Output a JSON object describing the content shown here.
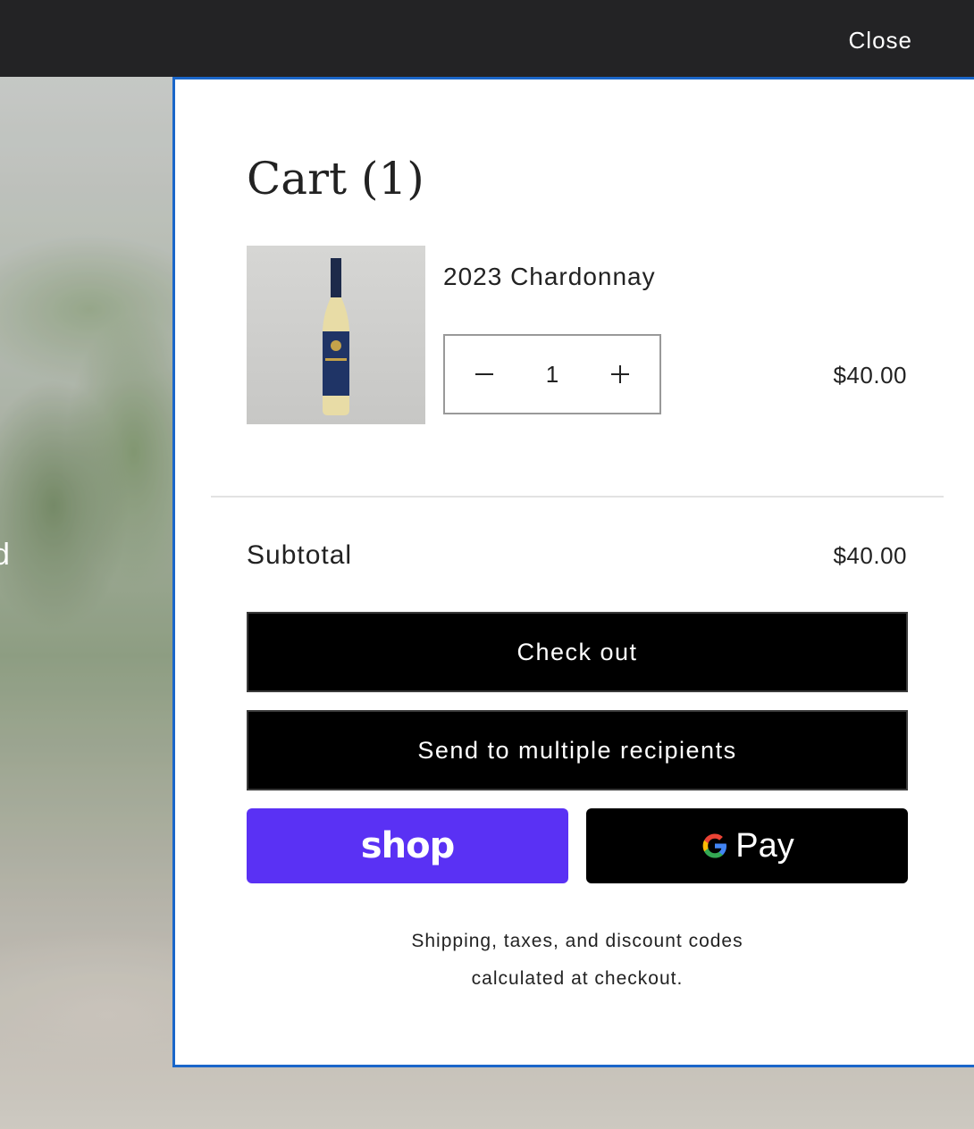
{
  "topbar": {
    "close_label": "Close"
  },
  "background": {
    "partial_text": "d"
  },
  "cart": {
    "title": "Cart (1)",
    "items": [
      {
        "name": "2023 Chardonnay",
        "quantity": "1",
        "price": "$40.00",
        "image_icon": "wine-bottle-icon"
      }
    ],
    "subtotal_label": "Subtotal",
    "subtotal_value": "$40.00",
    "checkout_label": "Check out",
    "multi_label": "Send to multiple recipients",
    "shop_pay_label": "shop",
    "gpay_label": "Pay",
    "note_line1": "Shipping, taxes, and discount codes",
    "note_line2": "calculated at checkout."
  },
  "colors": {
    "drawer_border": "#1a66c9",
    "shop_pay": "#5a31f4",
    "topbar": "#232325"
  }
}
